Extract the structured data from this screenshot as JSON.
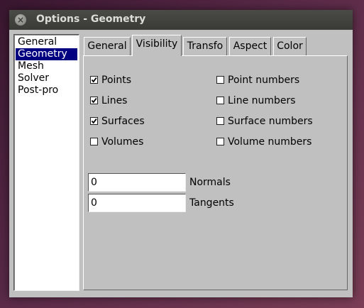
{
  "window": {
    "title": "Options - Geometry",
    "close_glyph": "×"
  },
  "browser": {
    "items": [
      {
        "label": "General",
        "selected": false
      },
      {
        "label": "Geometry",
        "selected": true
      },
      {
        "label": "Mesh",
        "selected": false
      },
      {
        "label": "Solver",
        "selected": false
      },
      {
        "label": "Post-pro",
        "selected": false
      }
    ]
  },
  "tabs": [
    {
      "label": "General",
      "active": false
    },
    {
      "label": "Visibility",
      "active": true
    },
    {
      "label": "Transfo",
      "active": false
    },
    {
      "label": "Aspect",
      "active": false
    },
    {
      "label": "Color",
      "active": false
    }
  ],
  "visibility": {
    "left_checks": [
      {
        "label": "Points",
        "checked": true
      },
      {
        "label": "Lines",
        "checked": true
      },
      {
        "label": "Surfaces",
        "checked": true
      },
      {
        "label": "Volumes",
        "checked": false
      }
    ],
    "right_checks": [
      {
        "label": "Point numbers",
        "checked": false
      },
      {
        "label": "Line numbers",
        "checked": false
      },
      {
        "label": "Surface numbers",
        "checked": false
      },
      {
        "label": "Volume numbers",
        "checked": false
      }
    ],
    "normals": {
      "value": "0",
      "label": "Normals"
    },
    "tangents": {
      "value": "0",
      "label": "Tangents"
    }
  },
  "colors": {
    "selection": "#000080",
    "panel": "#c0c0c0",
    "titlebar": "#3c3c39"
  }
}
